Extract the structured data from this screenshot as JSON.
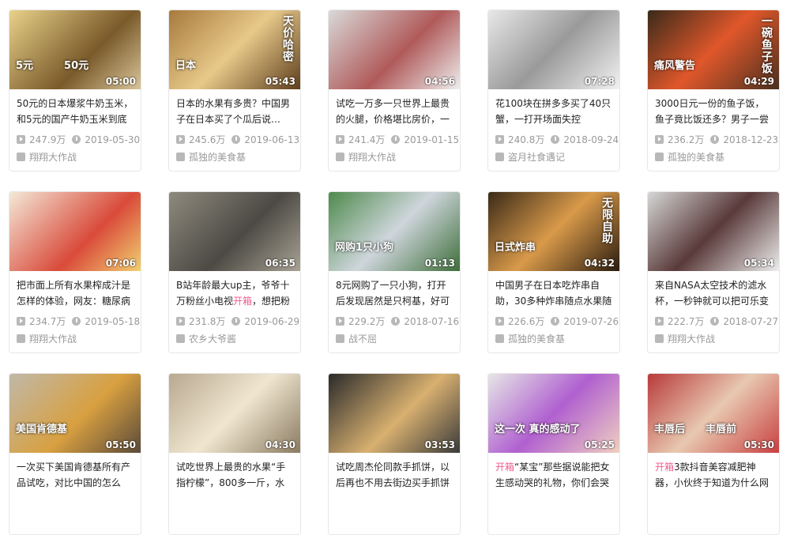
{
  "cards": [
    {
      "thumb_text": "",
      "thumb_caption": "5元　　　50元",
      "duration": "05:00",
      "title": "50元的日本爆浆牛奶玉米，和5元的国产牛奶玉米到底",
      "tag": "",
      "views": "247.9万",
      "date": "2019-05-30",
      "uploader": "翔翔大作战",
      "bg": "linear-gradient(135deg,#e9d28a,#7a5a2a 60%,#d8c59a)"
    },
    {
      "thumb_text": "天价哈密",
      "thumb_caption": "日本",
      "duration": "05:43",
      "title": "日本的水果有多贵？中国男子在日本买了个瓜后说…",
      "tag": "",
      "views": "245.6万",
      "date": "2019-06-13",
      "uploader": "孤独的美食基",
      "bg": "linear-gradient(135deg,#a77a3c,#e7c98a 50%,#5e3e1c)"
    },
    {
      "thumb_text": "",
      "thumb_caption": "",
      "duration": "04:56",
      "title": "试吃一万多一只世界上最贵的火腿，价格堪比房价，一",
      "tag": "",
      "views": "241.4万",
      "date": "2019-01-15",
      "uploader": "翔翔大作战",
      "bg": "linear-gradient(135deg,#d9d9d9,#b05a5a 55%,#eeeeee)"
    },
    {
      "thumb_text": "",
      "thumb_caption": "",
      "duration": "07:28",
      "title": "花100块在拼多多买了40只蟹，一打开场面失控",
      "tag": "",
      "views": "240.8万",
      "date": "2018-09-24",
      "uploader": "盗月社食遇记",
      "bg": "linear-gradient(135deg,#e8e8e8,#9a9a9a 50%,#f2f2f2)"
    },
    {
      "thumb_text": "一碗鱼子饭",
      "thumb_caption": "痛风警告",
      "duration": "04:29",
      "title": "3000日元一份的鱼子饭，鱼子竟比饭还多？男子一尝竟",
      "tag": "",
      "views": "236.2万",
      "date": "2018-12-23",
      "uploader": "孤独的美食基",
      "bg": "linear-gradient(135deg,#3a2a1a,#e0572a 50%,#4a3020)"
    },
    {
      "thumb_text": "",
      "thumb_caption": "",
      "duration": "07:06",
      "title": "把市面上所有水果榨成汁是怎样的体验，网友：糖尿病",
      "tag": "",
      "views": "234.7万",
      "date": "2019-05-18",
      "uploader": "翔翔大作战",
      "bg": "linear-gradient(135deg,#f4e9d8,#d94a3a 60%,#f1d070)"
    },
    {
      "thumb_text": "",
      "thumb_caption": "",
      "duration": "06:35",
      "title_pre": "B站年龄最大up主，爷爷十万粉丝小电视",
      "tag": "开箱",
      "title_post": "，想把粉",
      "views": "231.8万",
      "date": "2019-06-29",
      "uploader": "农乡大爷酱",
      "bg": "linear-gradient(135deg,#8e8a7e,#4c4a44 55%,#a8a294)"
    },
    {
      "thumb_text": "",
      "thumb_caption": "网购1只小狗",
      "duration": "01:13",
      "title": "8元网购了一只小狗，打开后发现居然是只柯基，好可",
      "tag": "",
      "views": "229.2万",
      "date": "2018-07-16",
      "uploader": "战不屈",
      "bg": "linear-gradient(135deg,#4e8a4c,#cfd6dc 50%,#3e6e3a)"
    },
    {
      "thumb_text": "无限自助",
      "thumb_caption": "日式炸串",
      "duration": "04:32",
      "title": "中国男子在日本吃炸串自助，30多种炸串随点水果随",
      "tag": "",
      "views": "226.6万",
      "date": "2019-07-26",
      "uploader": "孤独的美食基",
      "bg": "linear-gradient(135deg,#3a2a18,#d99a4a 50%,#2a1c10)"
    },
    {
      "thumb_text": "",
      "thumb_caption": "",
      "duration": "05:34",
      "title": "来自NASA太空技术的滤水杯，一秒钟就可以把可乐变",
      "tag": "",
      "views": "222.7万",
      "date": "2018-07-27",
      "uploader": "翔翔大作战",
      "bg": "linear-gradient(135deg,#d6d6d6,#5a3a3a 50%,#eeeeee)"
    },
    {
      "thumb_text": "",
      "thumb_caption": "美国肯德基",
      "duration": "05:50",
      "title": "一次买下美国肯德基所有产品试吃，对比中国的怎么",
      "tag": "",
      "views": "",
      "date": "",
      "uploader": "",
      "bg": "linear-gradient(135deg,#c0b8a8,#d8a040 55%,#5a4a3a)"
    },
    {
      "thumb_text": "",
      "thumb_caption": "",
      "duration": "04:30",
      "title": "试吃世界上最贵的水果“手指柠檬”，800多一斤，水果中",
      "tag": "",
      "views": "",
      "date": "",
      "uploader": "",
      "bg": "linear-gradient(135deg,#b8a890,#f0e6d0 50%,#8a7a60)"
    },
    {
      "thumb_text": "",
      "thumb_caption": "",
      "duration": "03:53",
      "title": "试吃周杰伦同款手抓饼，以后再也不用去街边买手抓饼",
      "tag": "",
      "views": "",
      "date": "",
      "uploader": "",
      "bg": "linear-gradient(135deg,#2a2a2a,#d8b070 55%,#3a3a3a)"
    },
    {
      "thumb_text": "",
      "thumb_caption": "这一次 真的感动了",
      "duration": "05:25",
      "title_pre": "",
      "tag": "开箱",
      "title_post": "“某宝”那些据说能把女生感动哭的礼物，你们会哭",
      "views": "",
      "date": "",
      "uploader": "",
      "bg": "linear-gradient(135deg,#e6e6e6,#b060d0 50%,#f0d0c0)"
    },
    {
      "thumb_text": "",
      "thumb_caption": "丰唇后　　丰唇前",
      "duration": "05:30",
      "title_pre": "",
      "tag": "开箱",
      "title_post": "3款抖音美容减肥神器，小伙终于知道为什么网",
      "views": "",
      "date": "",
      "uploader": "",
      "bg": "linear-gradient(135deg,#b83a3a,#e8c8b0 50%,#c84040)"
    }
  ]
}
